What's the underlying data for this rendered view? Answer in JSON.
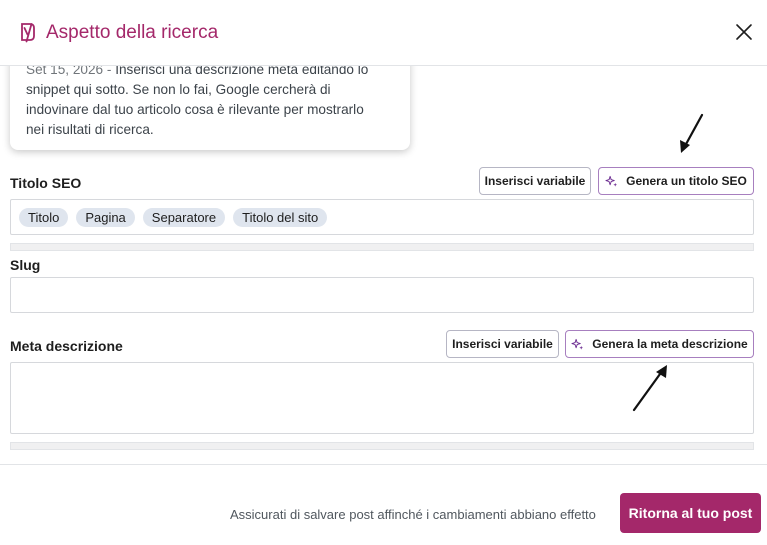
{
  "modal": {
    "title": "Aspetto della ricerca",
    "brand_color": "#a4286a"
  },
  "preview": {
    "date": "Set 15, 2026",
    "separator": "-",
    "line1": "Inserisci una descrizione meta editando lo",
    "line2": "snippet qui sotto. Se non lo fai, Google cercherà di",
    "line3": "indovinare dal tuo articolo cosa è rilevante per mostrarlo",
    "line4": "nei risultati di ricerca."
  },
  "seo_title": {
    "label": "Titolo SEO",
    "insert_variable_label": "Inserisci variabile",
    "generate_label": "Genera un titolo SEO",
    "chips": [
      "Titolo",
      "Pagina",
      "Separatore",
      "Titolo del sito"
    ]
  },
  "slug": {
    "label": "Slug",
    "value": ""
  },
  "meta_description": {
    "label": "Meta descrizione",
    "insert_variable_label": "Inserisci variabile",
    "generate_label": "Genera la meta descrizione",
    "value": ""
  },
  "footer": {
    "note": "Assicurati di salvare post affinché i cambiamenti abbiano effetto",
    "return_label": "Ritorna al tuo post"
  },
  "icons": {
    "logo": "yoast-logo-icon",
    "close": "close-icon",
    "ai": "sparkle-icon"
  }
}
